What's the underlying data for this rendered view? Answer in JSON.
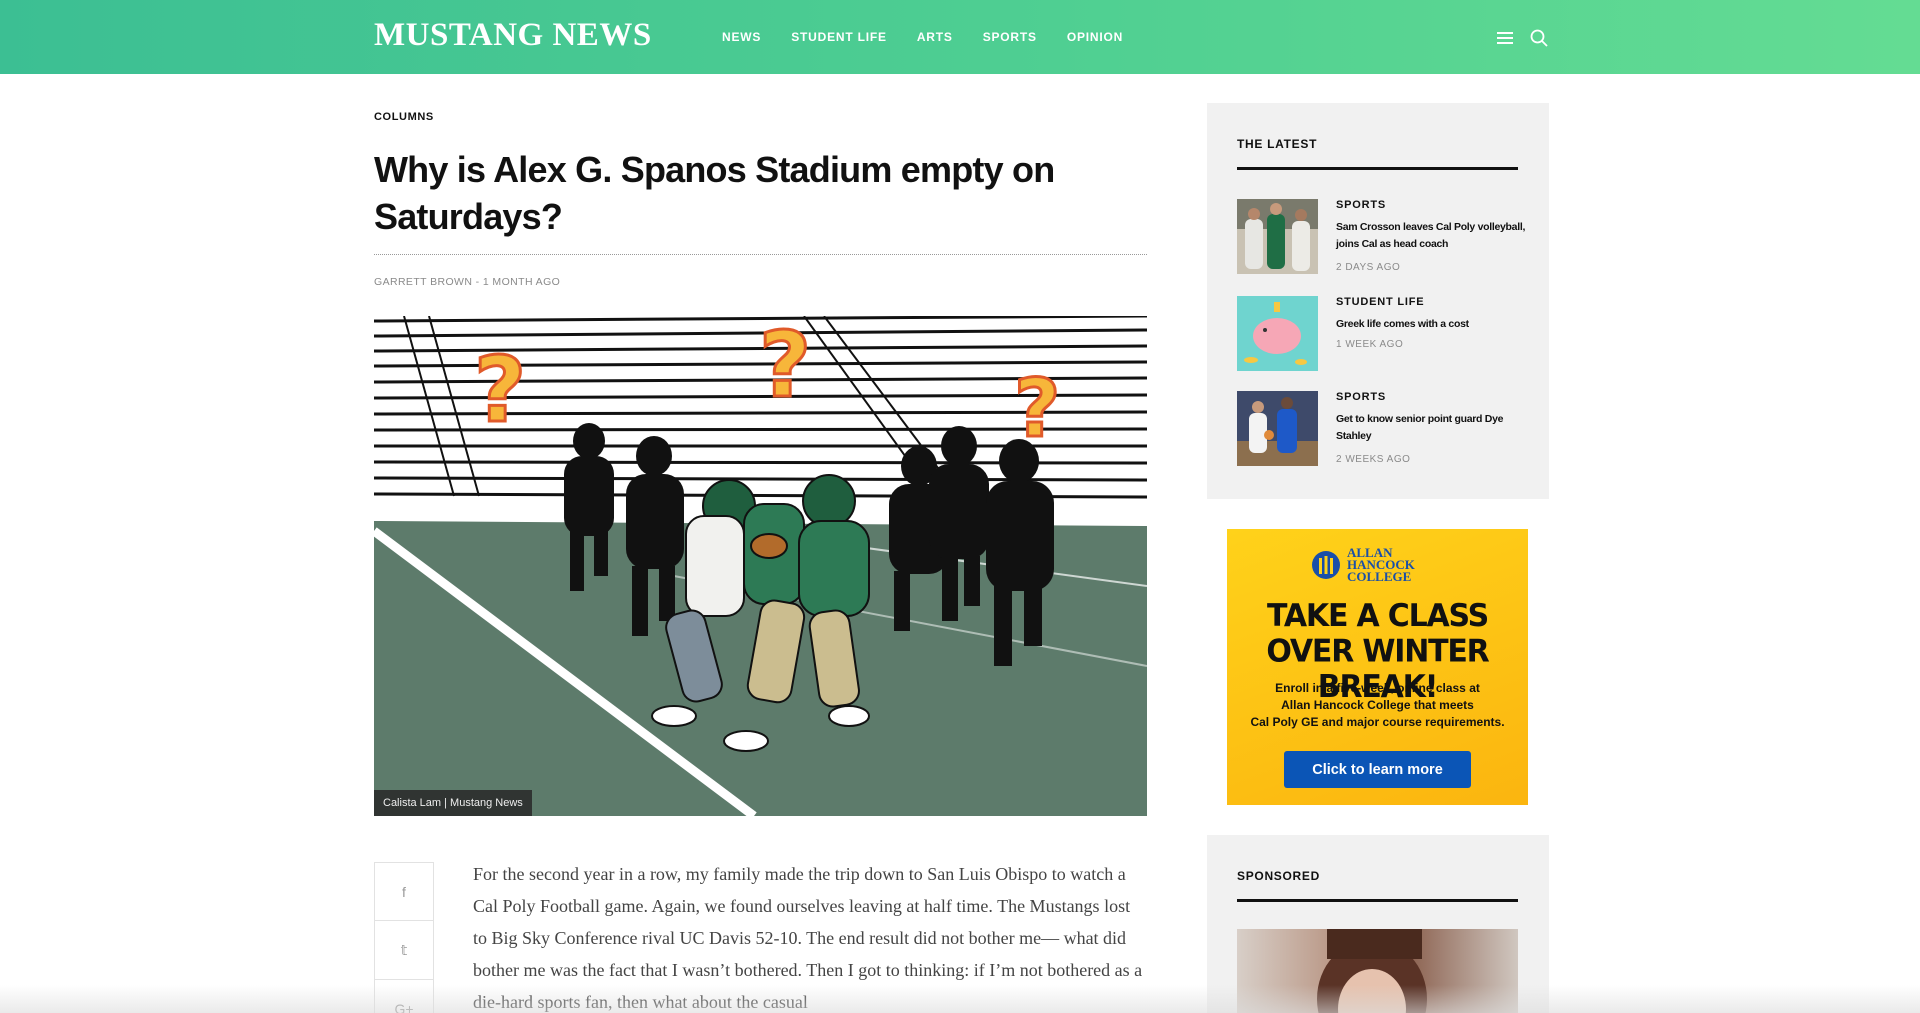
{
  "header": {
    "logo": "MUSTANG NEWS",
    "nav": [
      "NEWS",
      "STUDENT LIFE",
      "ARTS",
      "SPORTS",
      "OPINION"
    ],
    "icons": [
      "menu-icon",
      "search-icon"
    ],
    "gradient_colors": [
      "#3cbf93",
      "#64dc93"
    ]
  },
  "article": {
    "kicker": "COLUMNS",
    "title": "Why is Alex G. Spanos Stadium empty on Saturdays?",
    "byline": "GARRETT BROWN - 1 MONTH AGO",
    "image_caption": "Calista Lam | Mustang News",
    "share_icons": [
      "facebook-icon",
      "twitter-icon",
      "google-plus-icon"
    ],
    "share_glyphs": [
      "f",
      "𝕥",
      "G+"
    ],
    "body": "For the second year in a row, my family made the trip down to San Luis Obispo to watch a Cal Poly Football game. Again, we found ourselves leaving at half time. The Mustangs lost to Big Sky Conference rival UC Davis 52-10. The end result did not bother me— what did bother me was the fact that I wasn’t bothered. Then I got to thinking: if I’m not bothered as a die-hard sports fan, then what about the casual"
  },
  "sidebar": {
    "latest_title": "THE LATEST",
    "items": [
      {
        "category": "SPORTS",
        "title": "Sam Crosson leaves Cal Poly volleyball, joins Cal as head coach",
        "time": "2 DAYS AGO"
      },
      {
        "category": "STUDENT LIFE",
        "title": "Greek life comes with a cost",
        "time": "1 WEEK AGO"
      },
      {
        "category": "SPORTS",
        "title": "Get to know senior point guard Dye Stahley",
        "time": "2 WEEKS AGO"
      }
    ],
    "ad": {
      "logo_lines": [
        "ALLAN",
        "HANCOCK",
        "COLLEGE"
      ],
      "headline_1": "TAKE A CLASS",
      "headline_2": "OVER WINTER BREAK!",
      "subtext_1": "Enroll in a five-week, online class at",
      "subtext_2": "Allan Hancock College that meets",
      "subtext_3": "Cal Poly GE and major course requirements.",
      "button": "Click to learn more"
    },
    "sponsored_title": "SPONSORED"
  }
}
